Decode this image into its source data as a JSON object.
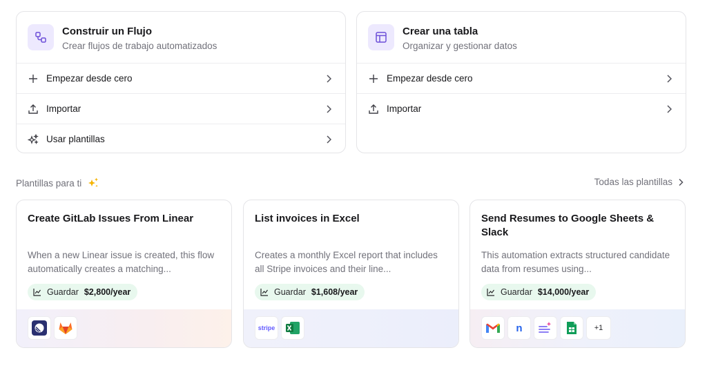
{
  "flow_panel": {
    "title": "Construir un Flujo",
    "subtitle": "Crear flujos de trabajo automatizados",
    "rows": [
      {
        "label": "Empezar desde cero",
        "icon": "plus-icon"
      },
      {
        "label": "Importar",
        "icon": "upload-icon"
      },
      {
        "label": "Usar plantillas",
        "icon": "sparkles-icon"
      }
    ]
  },
  "table_panel": {
    "title": "Crear una tabla",
    "subtitle": "Organizar y gestionar datos",
    "rows": [
      {
        "label": "Empezar desde cero",
        "icon": "plus-icon"
      },
      {
        "label": "Importar",
        "icon": "upload-icon"
      }
    ]
  },
  "templates_section": {
    "label": "Plantillas para ti",
    "all_link": "Todas las plantillas"
  },
  "cards": [
    {
      "title": "Create GitLab Issues From Linear",
      "description": "When a new Linear issue is created, this flow automatically creates a matching...",
      "save_label": "Guardar",
      "save_value": "$2,800/year",
      "apps": [
        "linear-icon",
        "gitlab-icon"
      ]
    },
    {
      "title": "List invoices in Excel",
      "description": "Creates a monthly Excel report that includes all Stripe invoices and their line...",
      "save_label": "Guardar",
      "save_value": "$1,608/year",
      "apps": [
        "stripe-icon",
        "excel-icon"
      ],
      "stripe_text": "stripe"
    },
    {
      "title": "Send Resumes to Google Sheets & Slack",
      "description": "This automation extracts structured candidate data from resumes using...",
      "save_label": "Guardar",
      "save_value": "$14,000/year",
      "apps": [
        "gmail-icon",
        "monday-icon",
        "ai-extract-icon",
        "google-sheets-icon"
      ],
      "more": "+1"
    }
  ],
  "colors": {
    "accent_bg": "#ede9fe",
    "accent": "#7c3aed",
    "save_pill": "#e8f8ee",
    "sparkle": "#f5b301"
  }
}
